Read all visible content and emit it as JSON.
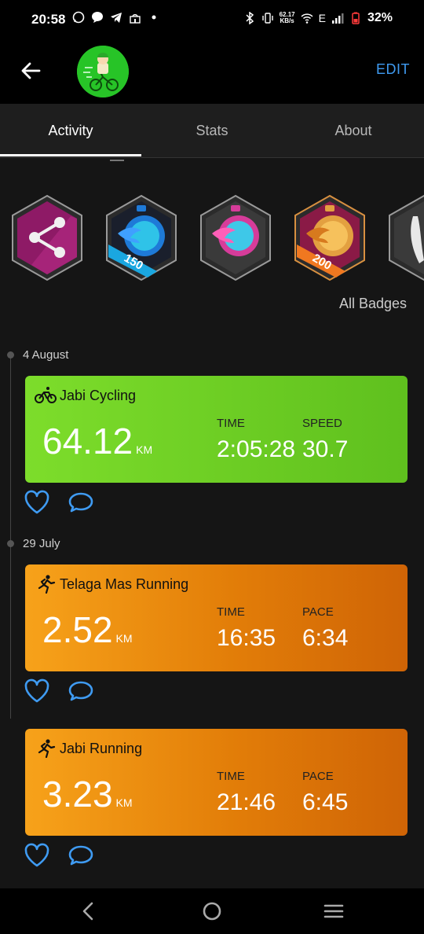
{
  "status": {
    "time": "20:58",
    "net_speed_value": "62.17",
    "net_speed_unit": "KB/s",
    "network": "E",
    "battery": "32%"
  },
  "header": {
    "edit_label": "EDIT"
  },
  "tabs": [
    {
      "label": "Activity",
      "active": true
    },
    {
      "label": "Stats",
      "active": false
    },
    {
      "label": "About",
      "active": false
    }
  ],
  "badges": [
    {
      "name": "share-badge",
      "color": "#8e1a66"
    },
    {
      "name": "stopwatch-150-badge",
      "number": "150",
      "color": "#1e7ad8"
    },
    {
      "name": "stopwatch-pink-badge",
      "color": "#d63c9a"
    },
    {
      "name": "stopwatch-200-badge",
      "number": "200",
      "color": "#d77a1e"
    },
    {
      "name": "partial-badge",
      "color": "#444444"
    }
  ],
  "all_badges_label": "All Badges",
  "activities": [
    {
      "date": "4 August",
      "type": "cycling",
      "title": "Jabi Cycling",
      "distance": "64.12",
      "unit": "KM",
      "metric1_label": "TIME",
      "metric1_value": "2:05:28",
      "metric2_label": "SPEED",
      "metric2_value": "30.7"
    },
    {
      "date": "29 July",
      "type": "running",
      "title": "Telaga Mas Running",
      "distance": "2.52",
      "unit": "KM",
      "metric1_label": "TIME",
      "metric1_value": "16:35",
      "metric2_label": "PACE",
      "metric2_value": "6:34"
    },
    {
      "date": "",
      "type": "running",
      "title": "Jabi Running",
      "distance": "3.23",
      "unit": "KM",
      "metric1_label": "TIME",
      "metric1_value": "21:46",
      "metric2_label": "PACE",
      "metric2_value": "6:45"
    }
  ],
  "colors": {
    "accent": "#3f9bf2",
    "cycling": "#6ccf24",
    "running": "#ea8a10"
  }
}
